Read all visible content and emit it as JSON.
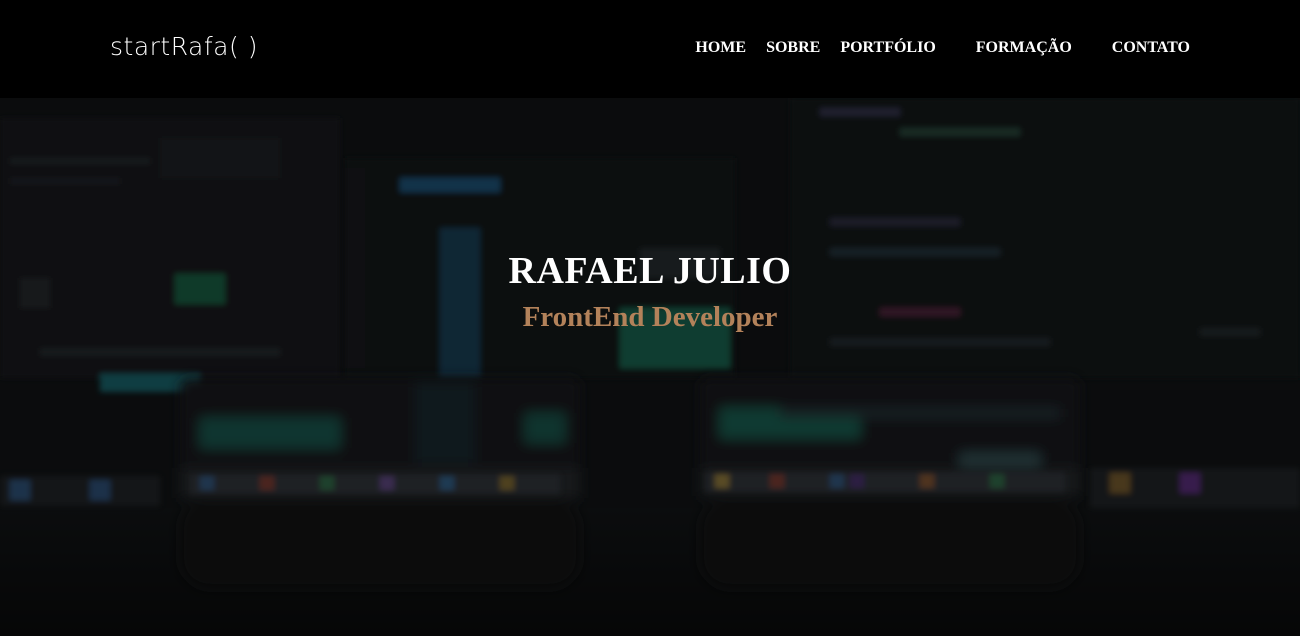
{
  "header": {
    "brand": "startRafa( )",
    "nav": [
      {
        "label": "HOME"
      },
      {
        "label": "SOBRE"
      },
      {
        "label": "PORTFÓLIO"
      },
      {
        "label": "FORMAÇÃO"
      },
      {
        "label": "CONTATO"
      }
    ]
  },
  "hero": {
    "name": "RAFAEL JULIO",
    "role": "FrontEnd Developer",
    "background_image": "dimmed-photo-of-laptops-with-code-editors"
  },
  "colors": {
    "header_bg": "#000000",
    "text": "#ffffff",
    "accent": "#b3825a",
    "hero_bg": "#121416"
  }
}
